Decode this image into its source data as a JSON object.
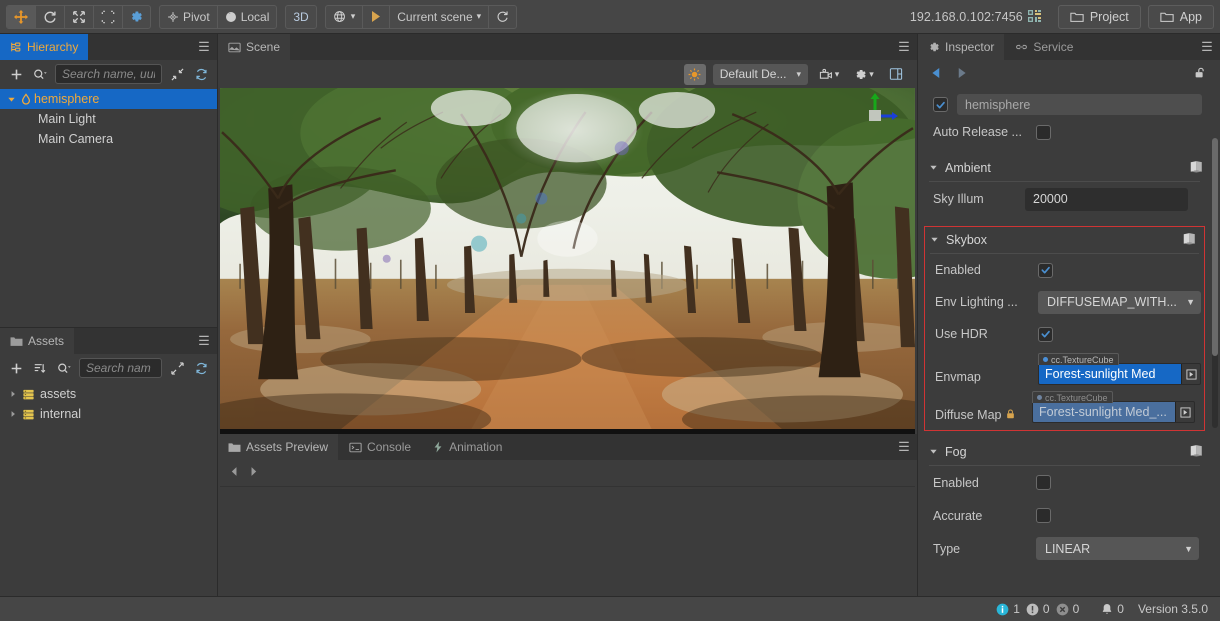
{
  "toolbar": {
    "transform_tools": [
      {
        "name": "move-tool",
        "icon": "move-icon",
        "active": true
      },
      {
        "name": "rotate-tool",
        "icon": "rotate-icon",
        "active": false
      },
      {
        "name": "scale-tool",
        "icon": "scale-icon",
        "active": false
      },
      {
        "name": "rect-tool",
        "icon": "rect-icon",
        "active": false
      },
      {
        "name": "settings-tool",
        "icon": "gear-icon",
        "active": false
      }
    ],
    "pivot_label": "Pivot",
    "coord_label": "Local",
    "dimension_label": "3D",
    "preview_device_icon": "globe-icon",
    "play_label": "play-icon",
    "scene_selector": "Current scene",
    "refresh_icon": "refresh-icon",
    "device_address": "192.168.0.102:7456",
    "qr_icon": "qr-code-icon",
    "project_label": "Project",
    "app_label": "App"
  },
  "hierarchy": {
    "tab_label": "Hierarchy",
    "tab_icon": "hierarchy-icon",
    "add_icon": "plus-icon",
    "search_icon": "search-icon",
    "search_placeholder": "Search name, uui",
    "collapse_icon": "collapse-icon",
    "sync_icon": "sync-icon",
    "menu_icon": "hamburger-icon",
    "nodes": [
      {
        "label": "hemisphere",
        "icon": "scene-droplet-icon",
        "depth": 0,
        "selected": true,
        "expanded": true
      },
      {
        "label": "Main Light",
        "icon": "",
        "depth": 1,
        "selected": false,
        "expanded": false
      },
      {
        "label": "Main Camera",
        "icon": "",
        "depth": 1,
        "selected": false,
        "expanded": false
      }
    ]
  },
  "assets": {
    "tab_label": "Assets",
    "tab_icon": "folder-icon",
    "add_icon": "plus-icon",
    "sort_icon": "sort-icon",
    "search_icon": "search-icon",
    "search_placeholder": "Search nam",
    "expand_icon": "expand-icon",
    "sync_icon": "sync-icon",
    "menu_icon": "hamburger-icon",
    "folders": [
      {
        "label": "assets",
        "icon": "db-folder-icon"
      },
      {
        "label": "internal",
        "icon": "db-folder-icon"
      }
    ]
  },
  "scene": {
    "tab_label": "Scene",
    "tab_icon": "scene-icon",
    "menu_icon": "hamburger-icon",
    "light_toggle_icon": "sun-icon",
    "renderer_label": "Default De...",
    "camera_icon": "camera-icon",
    "gizmo_settings_icon": "gear-icon",
    "layout_icon": "layout-icon",
    "axis_gizmo": "axis-gizmo"
  },
  "bottom_tabs": [
    {
      "label": "Assets Preview",
      "icon": "folder-icon",
      "active": true
    },
    {
      "label": "Console",
      "icon": "console-icon",
      "active": false
    },
    {
      "label": "Animation",
      "icon": "animation-icon",
      "active": false
    }
  ],
  "bottom_panel": {
    "menu_icon": "hamburger-icon",
    "prev_icon": "chevron-left-icon",
    "next_icon": "chevron-right-icon"
  },
  "inspector": {
    "tabs": [
      {
        "label": "Inspector",
        "icon": "gear-icon",
        "active": true
      },
      {
        "label": "Service",
        "icon": "link-icon",
        "active": false
      }
    ],
    "menu_icon": "hamburger-icon",
    "back_icon": "chevron-left-icon",
    "forward_icon": "chevron-right-icon",
    "lock_icon": "unlock-icon",
    "node_enabled": true,
    "node_name": "hemisphere",
    "auto_release_label": "Auto Release ...",
    "auto_release_checked": false,
    "sections": [
      {
        "title": "Ambient",
        "expanded": true,
        "help_icon": "book-icon",
        "highlighted": false,
        "rows": [
          {
            "label": "Sky Illum",
            "type": "text",
            "value": "20000"
          }
        ]
      },
      {
        "title": "Skybox",
        "expanded": true,
        "help_icon": "book-icon",
        "highlighted": true,
        "rows": [
          {
            "label": "Enabled",
            "type": "checkbox",
            "checked": true
          },
          {
            "label": "Env Lighting ...",
            "type": "dropdown",
            "value": "DIFFUSEMAP_WITH..."
          },
          {
            "label": "Use HDR",
            "type": "checkbox",
            "checked": true
          },
          {
            "label": "Envmap",
            "type": "asset",
            "asset_type": "cc.TextureCube",
            "value": "Forest-sunlight Med",
            "locked": false,
            "dim": false
          },
          {
            "label": "Diffuse Map",
            "type": "asset",
            "asset_type": "cc.TextureCube",
            "value": "Forest-sunlight Med_...",
            "locked": true,
            "dim": true
          }
        ]
      },
      {
        "title": "Fog",
        "expanded": true,
        "help_icon": "book-icon",
        "highlighted": false,
        "rows": [
          {
            "label": "Enabled",
            "type": "checkbox",
            "checked": false
          },
          {
            "label": "Accurate",
            "type": "checkbox",
            "checked": false
          },
          {
            "label": "Type",
            "type": "dropdown",
            "value": "LINEAR"
          }
        ]
      }
    ]
  },
  "statusbar": {
    "info_icon": "info-icon",
    "info_count": "1",
    "warn_icon": "warning-icon",
    "warn_count": "0",
    "error_icon": "error-icon",
    "error_count": "0",
    "bell_icon": "bell-icon",
    "bell_count": "0",
    "version": "Version 3.5.0"
  },
  "colors": {
    "accent_blue": "#1668c5",
    "accent_orange": "#f0a93b",
    "highlight_red": "#d03434",
    "panel_bg": "#3c3c3c",
    "chrome_bg": "#464646"
  }
}
